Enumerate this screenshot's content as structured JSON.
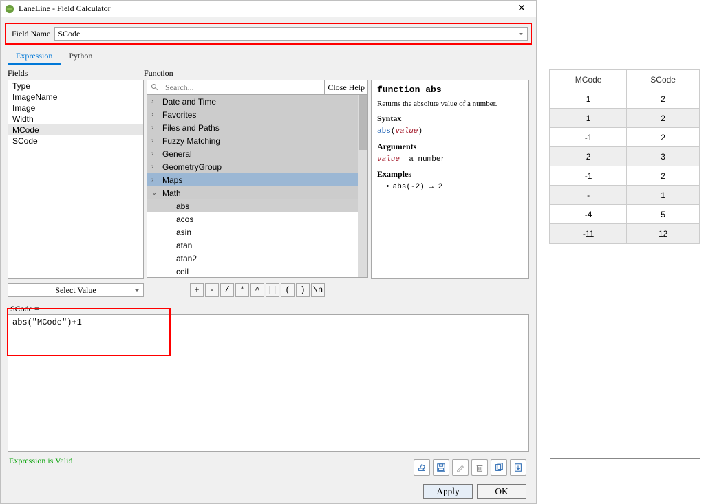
{
  "window": {
    "title": "LaneLine - Field Calculator"
  },
  "field": {
    "label": "Field Name",
    "value": "SCode"
  },
  "tabs": {
    "expression": "Expression",
    "python": "Python"
  },
  "headers": {
    "fields": "Fields",
    "function": "Function"
  },
  "fields_list": [
    "Type",
    "ImageName",
    "Image",
    "Width",
    "MCode",
    "SCode"
  ],
  "fields_selected": "MCode",
  "search": {
    "placeholder": "Search...",
    "close": "Close Help"
  },
  "func_cats": [
    {
      "label": "Date and Time",
      "open": false
    },
    {
      "label": "Favorites",
      "open": false
    },
    {
      "label": "Files and Paths",
      "open": false
    },
    {
      "label": "Fuzzy Matching",
      "open": false
    },
    {
      "label": "General",
      "open": false
    },
    {
      "label": "GeometryGroup",
      "open": false
    },
    {
      "label": "Maps",
      "open": false,
      "hl": true
    },
    {
      "label": "Math",
      "open": true
    }
  ],
  "math_funcs": [
    "abs",
    "acos",
    "asin",
    "atan",
    "atan2",
    "ceil"
  ],
  "math_selected": "abs",
  "help": {
    "title": "function abs",
    "desc": "Returns the absolute value of a number.",
    "syntax_label": "Syntax",
    "syntax_fn": "abs",
    "syntax_arg": "value",
    "args_label": "Arguments",
    "arg_name": "value",
    "arg_desc": "a number",
    "ex_label": "Examples",
    "ex_body": "abs(-2) → 2"
  },
  "selectvalue": "Select Value",
  "ops": [
    "+",
    "-",
    "/",
    "*",
    "^",
    "||",
    "(",
    ")",
    "\\n"
  ],
  "expr": {
    "label": "SCode =",
    "body": "abs(\"MCode\")+1"
  },
  "valid": "Expression is Valid",
  "buttons": {
    "apply": "Apply",
    "ok": "OK"
  },
  "grid": {
    "cols": [
      "MCode",
      "SCode"
    ],
    "rows": [
      [
        "1",
        "2"
      ],
      [
        "1",
        "2"
      ],
      [
        "-1",
        "2"
      ],
      [
        "2",
        "3"
      ],
      [
        "-1",
        "2"
      ],
      [
        "-",
        "1"
      ],
      [
        "-4",
        "5"
      ],
      [
        "-11",
        "12"
      ]
    ]
  }
}
